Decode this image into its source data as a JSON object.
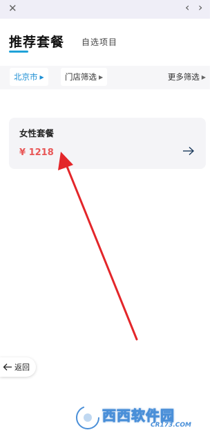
{
  "topbar": {
    "close_glyph": "✕",
    "prev_glyph": "‹",
    "next_glyph": "›"
  },
  "header": {
    "title": "推荐套餐",
    "alt_tab": "自选项目"
  },
  "filters": {
    "city": "北京市",
    "store": "门店筛选",
    "more": "更多筛选"
  },
  "packages": [
    {
      "name": "女性套餐",
      "price": "¥ 1218"
    }
  ],
  "back": {
    "label": "返回"
  },
  "watermark": {
    "brand": "西西软件园",
    "domain": "CR173.COM"
  },
  "colors": {
    "accent": "#1fa2d8",
    "price": "#e85656",
    "annotation": "#e3262a"
  }
}
